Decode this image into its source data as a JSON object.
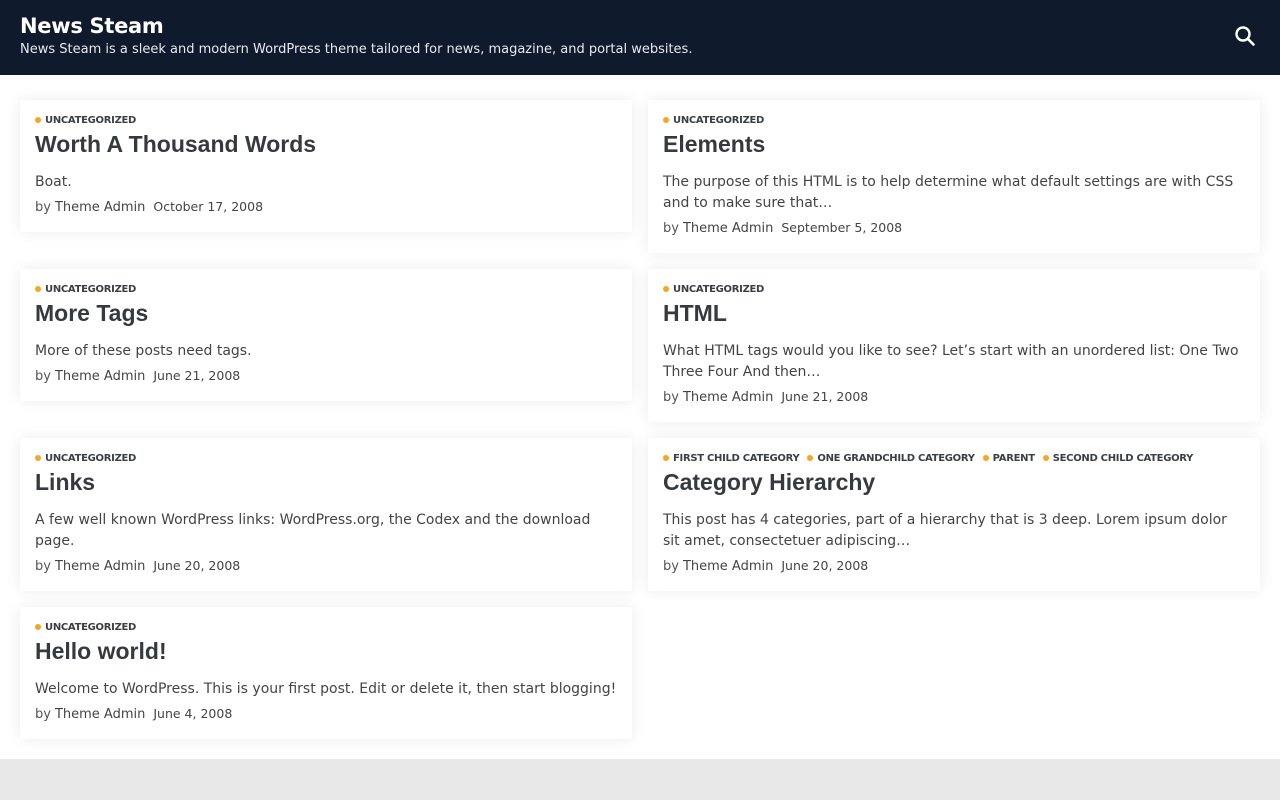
{
  "header": {
    "site_title": "News Steam",
    "tagline": "News Steam is a sleek and modern WordPress theme tailored for news, magazine, and portal websites.",
    "search_icon": "search-icon",
    "background": "#0f1b2d"
  },
  "accent_color": "#f5a623",
  "posts": [
    {
      "categories": [
        "UNCATEGORIZED"
      ],
      "title": "Worth A Thousand Words",
      "excerpt": "Boat.",
      "by": "by",
      "author": "Theme Admin",
      "date": "October 17, 2008"
    },
    {
      "categories": [
        "UNCATEGORIZED"
      ],
      "title": "Elements",
      "excerpt": "The purpose of this HTML is to help determine what default settings are with CSS and to make sure that…",
      "by": "by",
      "author": "Theme Admin",
      "date": "September 5, 2008"
    },
    {
      "categories": [
        "UNCATEGORIZED"
      ],
      "title": "More Tags",
      "excerpt": "More of these posts need tags.",
      "by": "by",
      "author": "Theme Admin",
      "date": "June 21, 2008"
    },
    {
      "categories": [
        "UNCATEGORIZED"
      ],
      "title": "HTML",
      "excerpt": "What HTML tags would you like to see? Let’s start with an unordered list: One Two Three Four And then…",
      "by": "by",
      "author": "Theme Admin",
      "date": "June 21, 2008"
    },
    {
      "categories": [
        "UNCATEGORIZED"
      ],
      "title": "Links",
      "excerpt": "A few well known WordPress links: WordPress.org, the Codex and the download page.",
      "by": "by",
      "author": "Theme Admin",
      "date": "June 20, 2008"
    },
    {
      "categories": [
        "FIRST CHILD CATEGORY",
        "ONE GRANDCHILD CATEGORY",
        "PARENT",
        "SECOND CHILD CATEGORY"
      ],
      "title": "Category Hierarchy",
      "excerpt": "This post has 4 categories, part of a hierarchy that is 3 deep. Lorem ipsum dolor sit amet, consectetuer adipiscing…",
      "by": "by",
      "author": "Theme Admin",
      "date": "June 20, 2008"
    },
    {
      "categories": [
        "UNCATEGORIZED"
      ],
      "title": "Hello world!",
      "excerpt": "Welcome to WordPress. This is your first post. Edit or delete it, then start blogging!",
      "by": "by",
      "author": "Theme Admin",
      "date": "June 4, 2008"
    }
  ]
}
